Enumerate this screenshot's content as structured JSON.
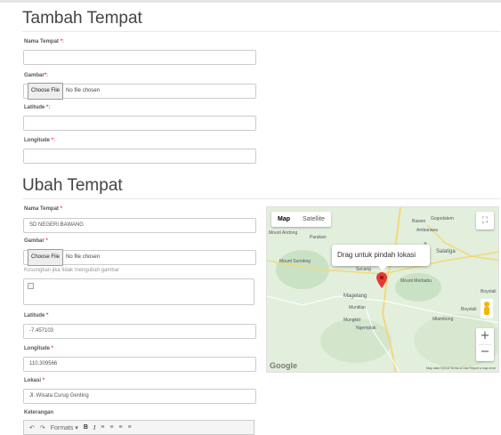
{
  "add": {
    "title": "Tambah Tempat",
    "nama_label": "Nama Tempat",
    "gambar_label": "Gambar",
    "latitude_label": "Latitude",
    "longitude_label": "Longitude",
    "req": "*:",
    "file_button": "Choose File",
    "file_status": "No file chosen"
  },
  "edit": {
    "title": "Ubah Tempat",
    "nama_label": "Nama Tempat",
    "nama_value": "SD NEGERI BAWANG",
    "gambar_label": "Gambar",
    "file_button": "Choose File",
    "file_status": "No file chosen",
    "gambar_hint": "Kosongkan jika tidak mengubah gambar",
    "latitude_label": "Latitude",
    "latitude_value": "-7.457103",
    "longitude_label": "Longitude",
    "longitude_value": "110.309566",
    "lokasi_label": "Lokasi",
    "lokasi_value": "Jl. Wisata Curug Genting",
    "keterangan_label": "Keterangan",
    "req": "*"
  },
  "editor_toolbar": {
    "undo": "↶",
    "redo": "↷",
    "formats": "Formats ▾",
    "bold": "B",
    "italic": "I",
    "align_left": "≡",
    "align_center": "≡",
    "align_right": "≡",
    "justify": "≡"
  },
  "map": {
    "map_tab": "Map",
    "satellite_tab": "Satellite",
    "info_text": "Drag untuk pindah lokasi",
    "info_close": "×",
    "zoom_in": "+",
    "zoom_out": "−",
    "fullscreen": "⛶",
    "logo": "Google",
    "attribution": "Map data ©2018   Terms of Use   Report a map error",
    "places": [
      "Gogodalem",
      "Bawen",
      "Ambarawa",
      "Salatiga",
      "Mount Andong",
      "Parakan",
      "Mount Sumbing",
      "Secang",
      "Mount Merbabu",
      "Magelang",
      "Muntilan",
      "Mungkid",
      "Boyolali",
      "Ngemplak",
      "Boyolali",
      "Mlambong"
    ],
    "marker_color": "#e53935",
    "road_color": "#f4d77a"
  }
}
